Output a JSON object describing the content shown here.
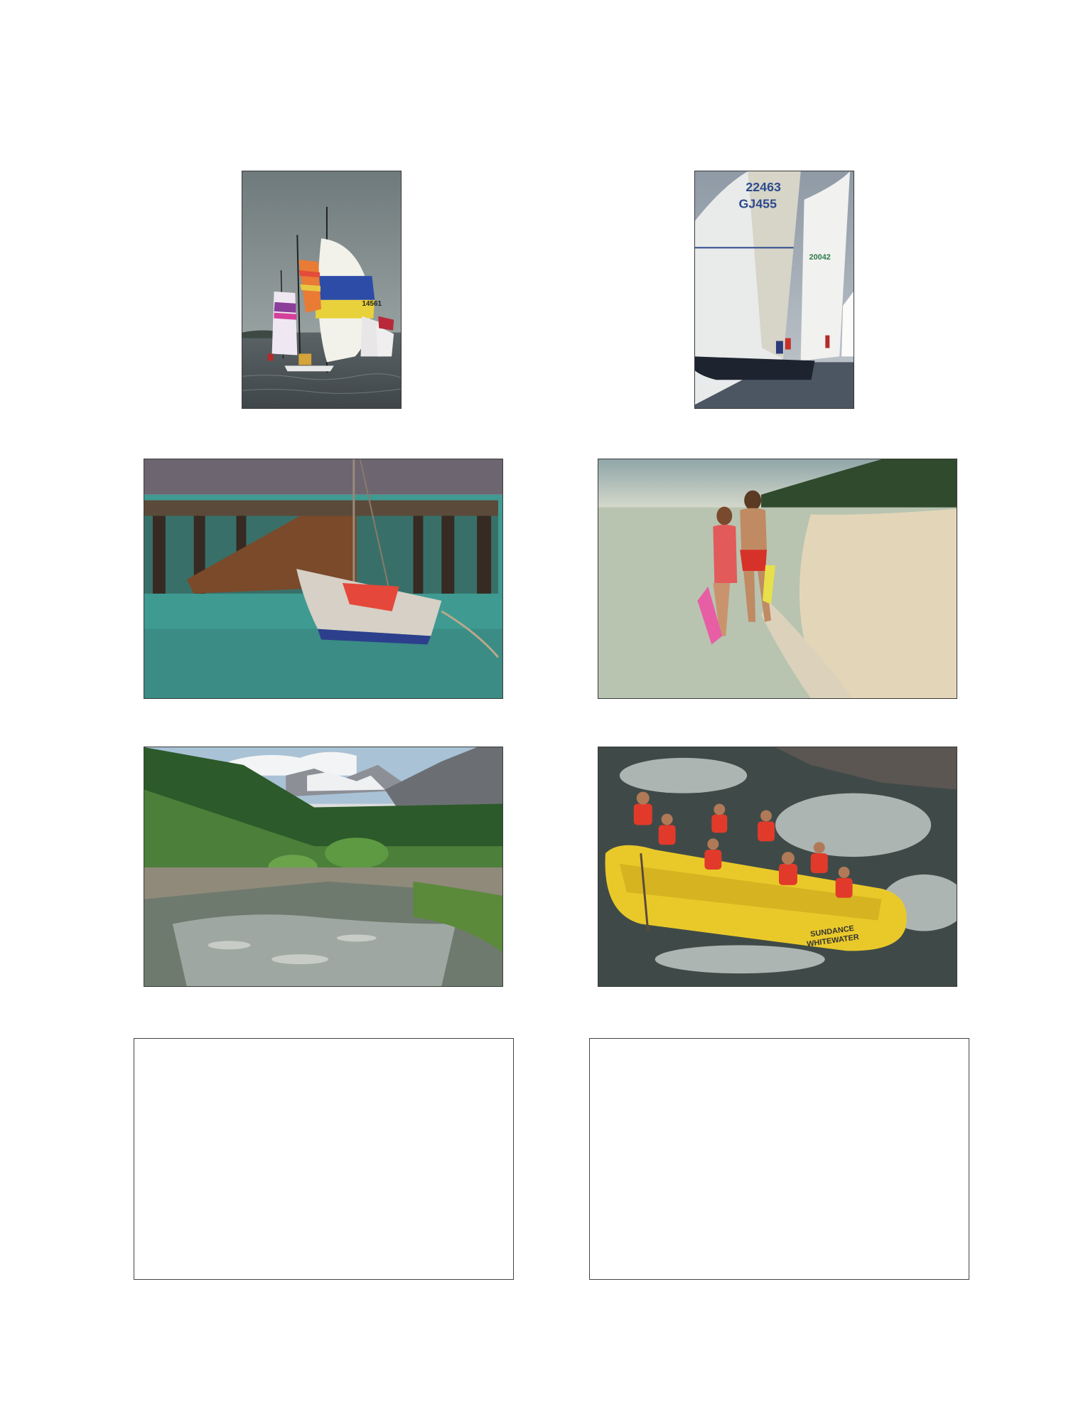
{
  "page": {
    "background": "#ffffff",
    "frame_border": "#3a3a3a"
  },
  "photos": [
    {
      "name": "spinnaker-regatta-photo",
      "sail_number": "14561"
    },
    {
      "name": "racing-sailboat-photo",
      "sail_numbers": [
        "22463",
        "GJ455",
        "20042"
      ]
    },
    {
      "name": "boat-at-pier-photo"
    },
    {
      "name": "couple-on-beach-photo"
    },
    {
      "name": "mountain-creek-photo"
    },
    {
      "name": "whitewater-rafting-photo",
      "raft_text": [
        "SUNDANCE",
        "WHITEWATER"
      ]
    }
  ],
  "placeholders": [
    {
      "name": "empty-frame-left"
    },
    {
      "name": "empty-frame-right"
    }
  ]
}
